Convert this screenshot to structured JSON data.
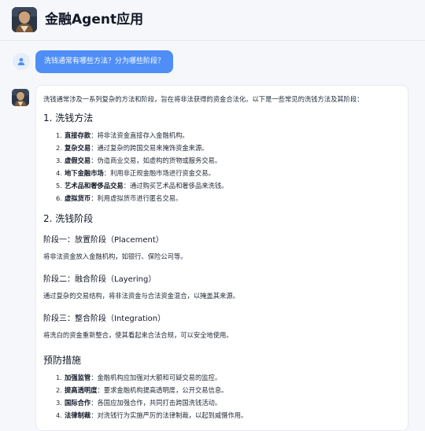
{
  "header": {
    "title": "金融Agent应用",
    "logo_icon": "portrait-logo-icon"
  },
  "user_message": {
    "avatar_icon": "user-icon",
    "text": "洗钱通常有哪些方法？分为哪些阶段？"
  },
  "assistant_message": {
    "avatar_icon": "portrait-avatar-icon",
    "intro": "洗钱通常涉及一系列复杂的方法和阶段，旨在将非法获得的资金合法化。以下是一些常见的洗钱方法及其阶段：",
    "section1": {
      "title": "1. 洗钱方法",
      "items": [
        {
          "num": "1.",
          "term": "直接存款",
          "desc": "：将非法资金直接存入金融机构。"
        },
        {
          "num": "2.",
          "term": "复杂交易",
          "desc": "：通过复杂的跨国交易来掩饰资金来源。"
        },
        {
          "num": "3.",
          "term": "虚假交易",
          "desc": "：伪造商业交易，如虚构的货物或服务交易。"
        },
        {
          "num": "4.",
          "term": "地下金融市场",
          "desc": "：利用非正规金融市场进行资金交易。"
        },
        {
          "num": "5.",
          "term": "艺术品和奢侈品交易",
          "desc": "：通过购买艺术品和奢侈品来洗钱。"
        },
        {
          "num": "6.",
          "term": "虚拟货币",
          "desc": "：利用虚拟货币进行匿名交易。"
        }
      ]
    },
    "section2": {
      "title": "2. 洗钱阶段",
      "stages": [
        {
          "title": "阶段一：放置阶段（Placement）",
          "desc": "将非法资金放入金融机构，如银行、保险公司等。"
        },
        {
          "title": "阶段二：融合阶段（Layering）",
          "desc": "通过复杂的交易结构，将非法资金与合法资金混合，以掩盖其来源。"
        },
        {
          "title": "阶段三：整合阶段（Integration）",
          "desc": "将洗白的资金重新整合，使其看起来合法合规，可以安全地使用。"
        }
      ]
    },
    "section3": {
      "title": "预防措施",
      "items": [
        {
          "num": "1.",
          "term": "加强监管",
          "desc": "：金融机构应加强对大额和可疑交易的监控。"
        },
        {
          "num": "2.",
          "term": "提高透明度",
          "desc": "：要求金融机构提高透明度，公开交易信息。"
        },
        {
          "num": "3.",
          "term": "国际合作",
          "desc": "：各国应加强合作，共同打击跨国洗钱活动。"
        },
        {
          "num": "4.",
          "term": "法律制裁",
          "desc": "：对洗钱行为实施严厉的法律制裁，以起到威慑作用。"
        }
      ]
    }
  }
}
